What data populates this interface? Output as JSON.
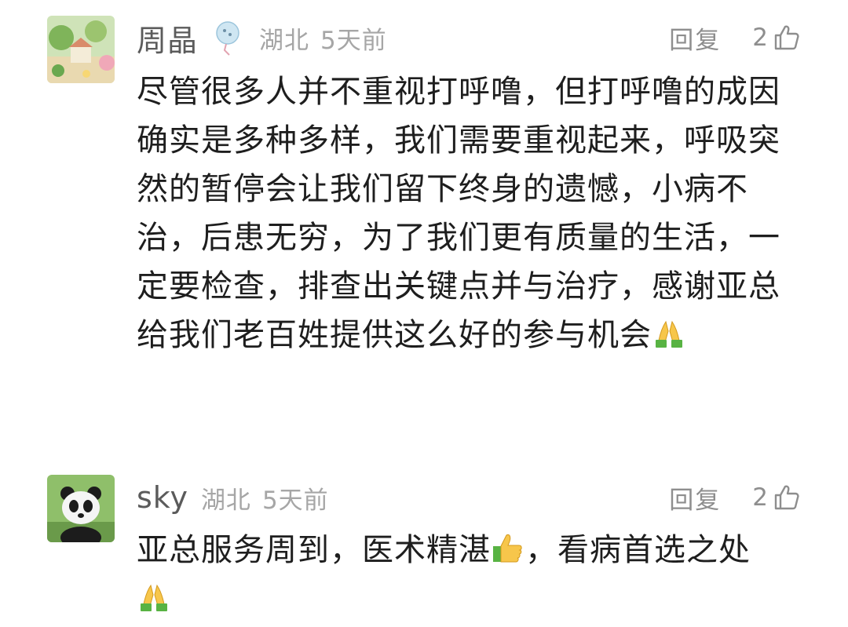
{
  "comments": [
    {
      "nickname": "周晶",
      "region": "湖北",
      "time": "5天前",
      "reply_label": "回复",
      "likes": "2",
      "text_main": "尽管很多人并不重视打呼噜，但打呼噜的成因确实是多种多样，我们需要重视起来，呼吸突然的暂停会让我们留下终身的遗憾，小病不治，后患无穷，为了我们更有质量的生活，一定要检查，排查出关键点并与治疗，感谢亚总给我们老百姓提供这么好的参与机会",
      "text_tail_emoji": "folded-hands",
      "avatar_icon": "garden-avatar-icon"
    },
    {
      "nickname": "sky",
      "region": "湖北",
      "time": "5天前",
      "reply_label": "回复",
      "likes": "2",
      "text_part1": "亚总服务周到，医术精湛",
      "text_mid_emoji": "thumbs-up",
      "text_part2": "，看病首选之处",
      "text_tail_emoji": "folded-hands",
      "avatar_icon": "panda-avatar-icon"
    }
  ],
  "colors": {
    "nickname": "#5b5b5b",
    "meta": "#a6a6a6",
    "action": "#8e8e8e",
    "text": "#1e1e1e"
  }
}
